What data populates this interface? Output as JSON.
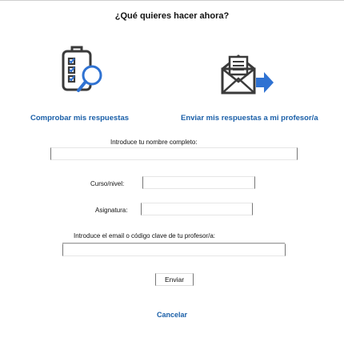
{
  "dialog": {
    "title": "¿Qué quieres hacer ahora?"
  },
  "options": {
    "check": {
      "label": "Comprobar mis respuestas",
      "icon": "clipboard-checklist-magnifier-icon"
    },
    "send": {
      "label": "Enviar mis respuestas a mi profesor/a",
      "icon": "envelope-arrow-icon"
    }
  },
  "form": {
    "name_label": "Introduce tu nombre completo:",
    "name_value": "",
    "course_label": "Curso/nivel:",
    "course_value": "",
    "subject_label": "Asignatura:",
    "subject_value": "",
    "email_label": "Introduce el email o código clave de tu profesor/a:",
    "email_value": "",
    "submit_label": "Enviar"
  },
  "footer": {
    "cancel_label": "Cancelar"
  },
  "colors": {
    "accent": "#1a5fa8",
    "icon_blue": "#2f72d2",
    "icon_gray": "#3a3a3a"
  }
}
